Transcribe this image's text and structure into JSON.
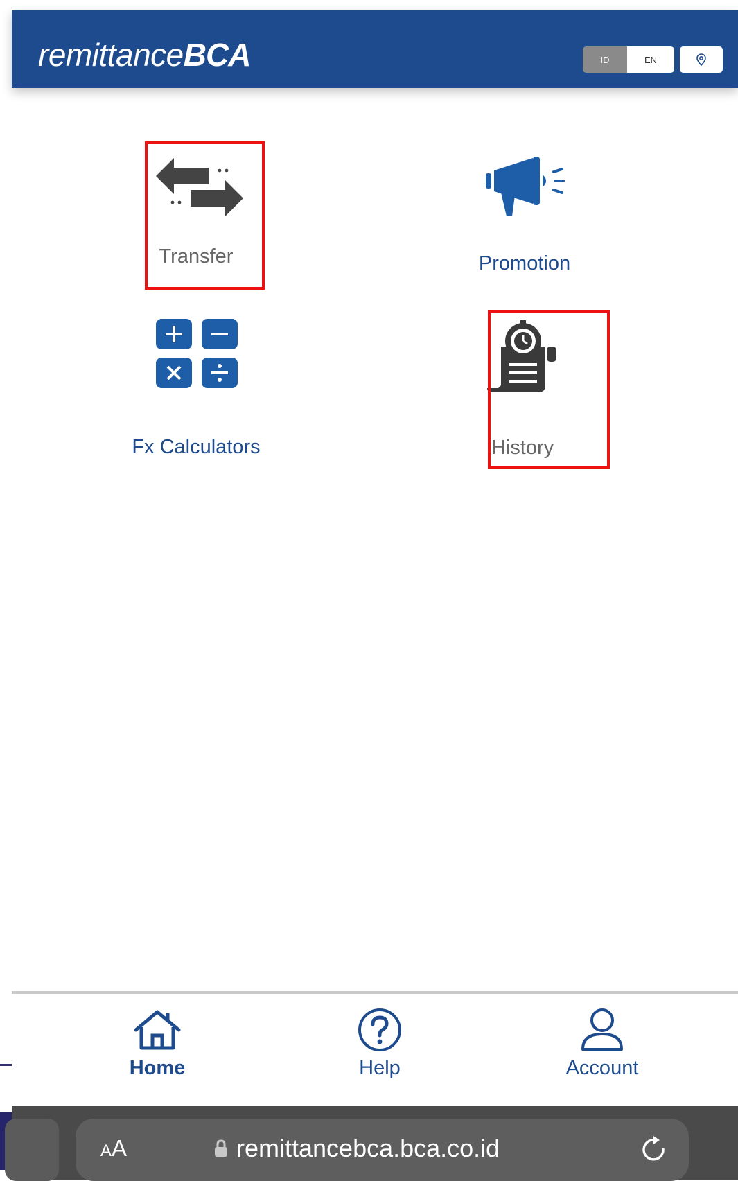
{
  "header": {
    "logo_part1": "remittance",
    "logo_part2": "BCA",
    "lang_id": "ID",
    "lang_en": "EN",
    "location_icon": "location-pin-icon"
  },
  "menu": {
    "transfer": {
      "label": "Transfer",
      "icon": "transfer-arrows-icon"
    },
    "promotion": {
      "label": "Promotion",
      "icon": "megaphone-icon"
    },
    "fx_calculators": {
      "label": "Fx Calculators",
      "icon": "calculator-icon"
    },
    "history": {
      "label": "History",
      "icon": "history-receipt-icon"
    }
  },
  "bottom_nav": {
    "home": {
      "label": "Home",
      "icon": "home-icon"
    },
    "help": {
      "label": "Help",
      "icon": "help-icon"
    },
    "account": {
      "label": "Account",
      "icon": "account-icon"
    }
  },
  "browser": {
    "text_size_small": "A",
    "text_size_large": "A",
    "url": "remittancebca.bca.co.id"
  },
  "colors": {
    "brand_blue": "#1e4b8d",
    "icon_gray": "#444444",
    "highlight_red": "#ee1111"
  }
}
